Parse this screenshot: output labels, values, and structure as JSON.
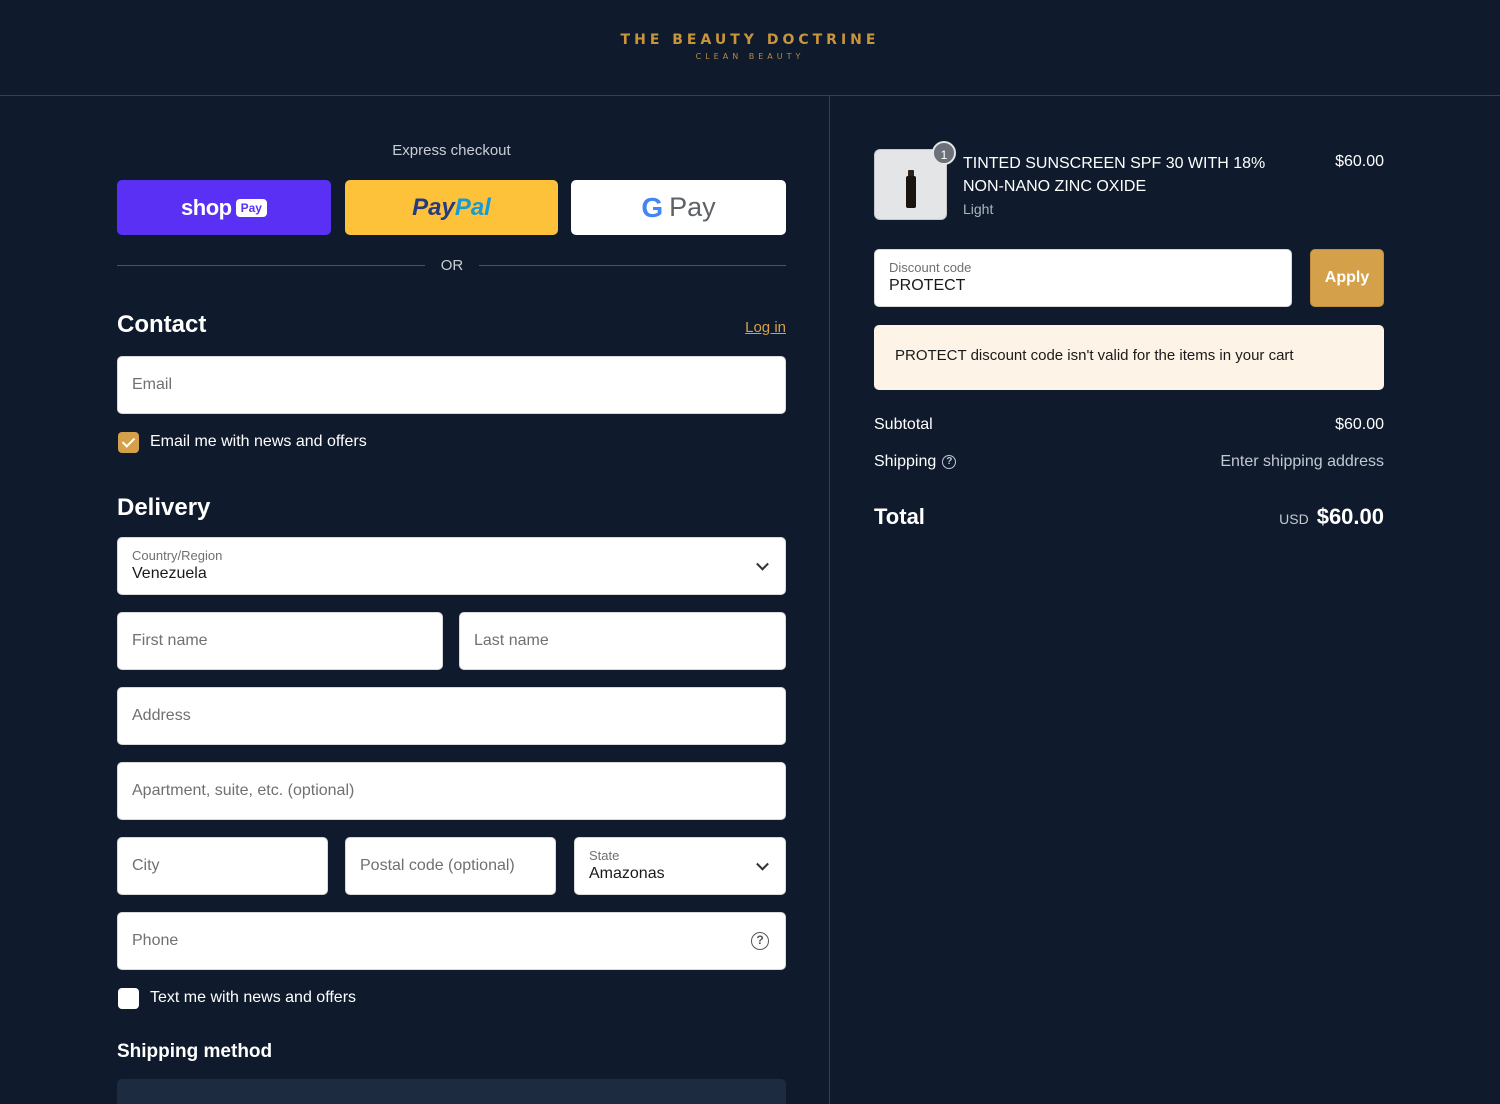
{
  "brand": {
    "name": "THE BEAUTY DOCTRINE",
    "tagline": "CLEAN BEAUTY"
  },
  "express": {
    "label": "Express checkout",
    "shop_word": "shop",
    "shop_pay": "Pay",
    "paypal_a": "Pay",
    "paypal_b": "Pal",
    "gpay_g": "G",
    "gpay_pay": "Pay",
    "or": "OR"
  },
  "contact": {
    "title": "Contact",
    "login": "Log in",
    "email_placeholder": "Email",
    "news_label": "Email me with news and offers",
    "news_checked": true
  },
  "delivery": {
    "title": "Delivery",
    "country_label": "Country/Region",
    "country_value": "Venezuela",
    "first_name_placeholder": "First name",
    "last_name_placeholder": "Last name",
    "address_placeholder": "Address",
    "apartment_placeholder": "Apartment, suite, etc. (optional)",
    "city_placeholder": "City",
    "postal_placeholder": "Postal code (optional)",
    "state_label": "State",
    "state_value": "Amazonas",
    "phone_placeholder": "Phone",
    "text_label": "Text me with news and offers",
    "text_checked": false
  },
  "shipping_method": {
    "title": "Shipping method"
  },
  "order": {
    "item": {
      "name": "TINTED SUNSCREEN SPF 30 WITH 18% NON-NANO ZINC OXIDE",
      "variant": "Light",
      "price": "$60.00",
      "quantity": "1"
    },
    "discount": {
      "label": "Discount code",
      "value": "PROTECT",
      "apply": "Apply",
      "error_code": "PROTECT",
      "error_text": " discount code isn't valid for the items in your cart"
    },
    "subtotal_label": "Subtotal",
    "subtotal_value": "$60.00",
    "shipping_label": "Shipping",
    "shipping_value": "Enter shipping address",
    "total_label": "Total",
    "total_currency": "USD",
    "total_value": "$60.00"
  },
  "colors": {
    "background": "#0f1b2c",
    "accent_gold": "#d4a04a",
    "shop_pay_purple": "#5a31f4",
    "paypal_yellow": "#fec13a",
    "error_bg": "#fdf3e7"
  }
}
